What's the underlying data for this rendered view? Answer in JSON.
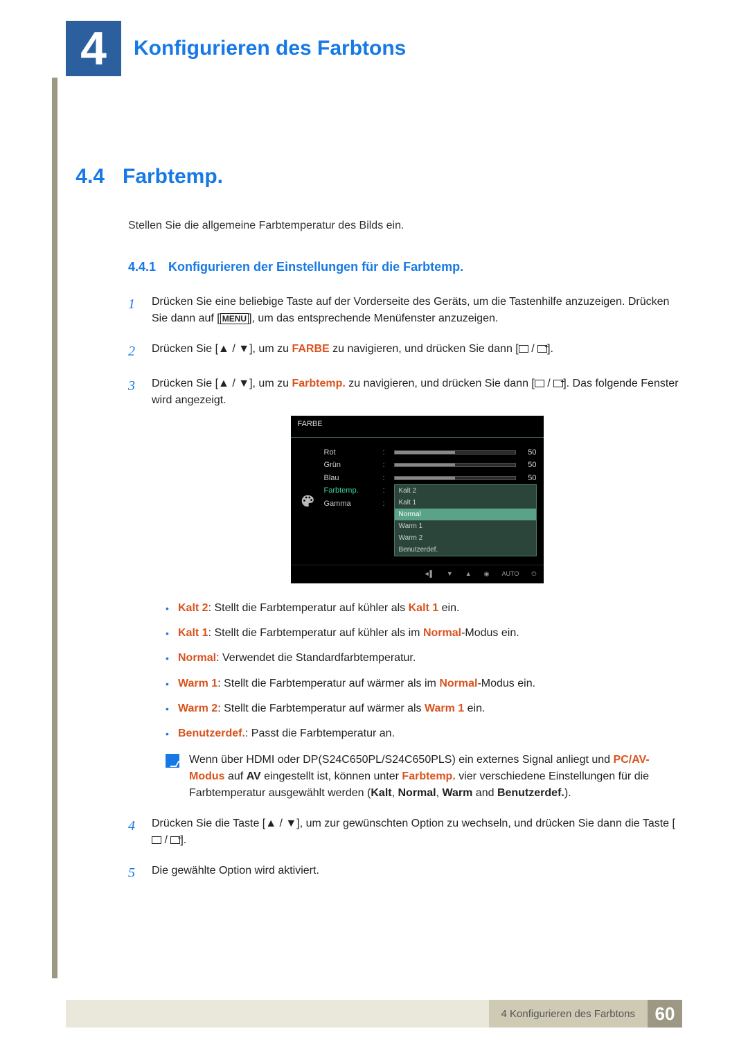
{
  "chapter": {
    "number": "4",
    "title": "Konfigurieren des Farbtons"
  },
  "section": {
    "number": "4.4",
    "title": "Farbtemp."
  },
  "intro": "Stellen Sie die allgemeine Farbtemperatur des Bilds ein.",
  "subsection": {
    "number": "4.4.1",
    "title": "Konfigurieren der Einstellungen für die Farbtemp."
  },
  "steps": {
    "s1a": "Drücken Sie eine beliebige Taste auf der Vorderseite des Geräts, um die Tastenhilfe anzuzeigen. Drücken Sie dann auf [",
    "s1b": "], um das entsprechende Menüfenster anzuzeigen.",
    "s2a": "Drücken Sie [",
    "s2b": "], um zu ",
    "s2c": "FARBE",
    "s2d": " zu navigieren, und drücken Sie dann [",
    "s2e": "].",
    "s3a": "Drücken Sie [",
    "s3b": "], um zu ",
    "s3c": "Farbtemp.",
    "s3d": " zu navigieren, und drücken Sie dann [",
    "s3e": "]. Das folgende Fenster wird angezeigt.",
    "s4a": "Drücken Sie die Taste [",
    "s4b": "], um zur gewünschten Option zu wechseln, und drücken Sie dann die Taste [",
    "s4c": "].",
    "s5": "Die gewählte Option wird aktiviert."
  },
  "menu_label": "MENU",
  "osd": {
    "title": "FARBE",
    "items": {
      "rot": "Rot",
      "gruen": "Grün",
      "blau": "Blau",
      "farbtemp": "Farbtemp.",
      "gamma": "Gamma"
    },
    "value": "50",
    "options": {
      "kalt2": "Kalt 2",
      "kalt1": "Kalt 1",
      "normal": "Normal",
      "warm1": "Warm 1",
      "warm2": "Warm 2",
      "benutzer": "Benutzerdef."
    },
    "auto": "AUTO"
  },
  "bullets": {
    "b1a": "Kalt 2",
    "b1b": ": Stellt die Farbtemperatur auf kühler als ",
    "b1c": "Kalt 1",
    "b1d": " ein.",
    "b2a": "Kalt 1",
    "b2b": ": Stellt die Farbtemperatur auf kühler als im ",
    "b2c": "Normal",
    "b2d": "-Modus ein.",
    "b3a": "Normal",
    "b3b": ": Verwendet die Standardfarbtemperatur.",
    "b4a": "Warm 1",
    "b4b": ": Stellt die Farbtemperatur auf wärmer als im ",
    "b4c": "Normal",
    "b4d": "-Modus ein.",
    "b5a": "Warm 2",
    "b5b": ": Stellt die Farbtemperatur auf wärmer als ",
    "b5c": "Warm 1",
    "b5d": " ein.",
    "b6a": "Benutzerdef.",
    "b6b": ": Passt die Farbtemperatur an."
  },
  "note": {
    "a": "Wenn über HDMI oder DP(S24C650PL/S24C650PLS) ein externes Signal anliegt und ",
    "b": "PC/AV-Modus",
    "c": " auf ",
    "d": "AV",
    "e": " eingestellt ist, können unter ",
    "f": "Farbtemp.",
    "g": " vier verschiedene Einstellungen für die Farbtemperatur ausgewählt werden (",
    "h": "Kalt",
    "i": ", ",
    "j": "Normal",
    "k": ", ",
    "l": "Warm",
    "m": " and ",
    "n": "Benutzerdef.",
    "o": ")."
  },
  "footer": {
    "text": "4 Konfigurieren des Farbtons",
    "page": "60"
  }
}
